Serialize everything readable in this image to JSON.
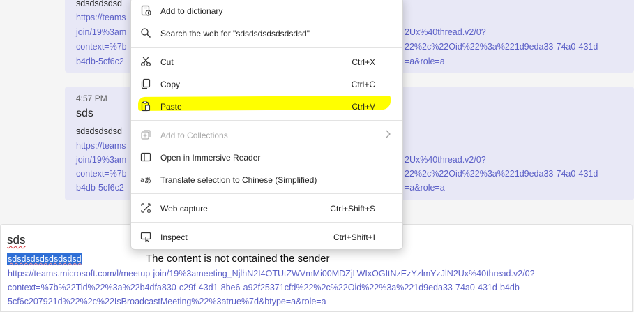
{
  "messages": [
    {
      "line": "sdsdsdsdsd",
      "links_left": [
        "https://teams",
        "join/19%3am",
        "context=%7b",
        "b4db-5cf6c2"
      ],
      "links_right": [
        "2Ux%40thread.v2/0?",
        "22%2c%22Oid%22%3a%221d9eda33-74a0-431d-",
        "=a&role=a"
      ]
    },
    {
      "time": "4:57 PM",
      "subject": "sds",
      "line": "sdsdsdsdsd",
      "links_left": [
        "https://teams",
        "join/19%3am",
        "context=%7b",
        "b4db-5cf6c2"
      ],
      "links_right": [
        "2Ux%40thread.v2/0?",
        "22%2c%22Oid%22%3a%221d9eda33-74a0-431d-",
        "=a&role=a"
      ]
    }
  ],
  "compose": {
    "subject": "sds",
    "selected_text": "sdsdsdsdsdsdsdsd",
    "annotation": "The content is not contained the sender",
    "link_lines": [
      "https://teams.microsoft.com/l/meetup-join/19%3ameeting_NjlhN2I4OTUtZWVmMi00MDZjLWIxOGItNzEzYzlmYzJlN2Ux%40thread.v2/0?",
      "context=%7b%22Tid%22%3a%22b4dfa830-c29f-43d1-8be6-a92f25371cfd%22%2c%22Oid%22%3a%221d9eda33-74a0-431d-b4db-",
      "5cf6c207921d%22%2c%22IsBroadcastMeeting%22%3atrue%7d&btype=a&role=a"
    ]
  },
  "context_menu": {
    "add_to_dictionary": {
      "label": "Add to dictionary",
      "icon": "book-add-icon"
    },
    "search_web": {
      "label": "Search the web for \"sdsdsdsdsdsdsdsd\"",
      "icon": "search-icon"
    },
    "cut": {
      "label": "Cut",
      "shortcut": "Ctrl+X",
      "icon": "scissors-icon"
    },
    "copy": {
      "label": "Copy",
      "shortcut": "Ctrl+C",
      "icon": "copy-icon"
    },
    "paste": {
      "label": "Paste",
      "shortcut": "Ctrl+V",
      "icon": "clipboard-icon"
    },
    "add_to_collections": {
      "label": "Add to Collections",
      "icon": "collections-icon",
      "disabled": true
    },
    "immersive_reader": {
      "label": "Open in Immersive Reader",
      "icon": "immersive-reader-icon"
    },
    "translate": {
      "label": "Translate selection to Chinese (Simplified)",
      "icon": "translate-icon"
    },
    "web_capture": {
      "label": "Web capture",
      "shortcut": "Ctrl+Shift+S",
      "icon": "web-capture-icon"
    },
    "inspect": {
      "label": "Inspect",
      "shortcut": "Ctrl+Shift+I",
      "icon": "inspect-icon"
    }
  },
  "colors": {
    "link": "#5b5fc7",
    "highlight": "#ffff00",
    "selection": "#2f6fd6",
    "message_bg": "#e8e8f6"
  }
}
